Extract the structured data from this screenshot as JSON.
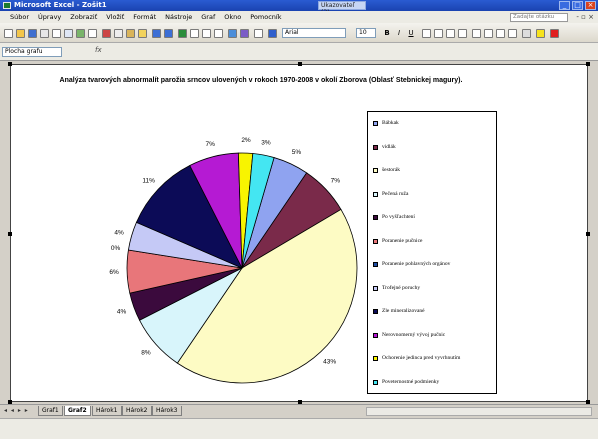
{
  "window": {
    "title": "Microsoft Excel - Zošit1",
    "ask_box": "Ukazovateľ (3)"
  },
  "menu": {
    "items": [
      "Súbor",
      "Úpravy",
      "Zobraziť",
      "Vložiť",
      "Formát",
      "Nástroje",
      "Graf",
      "Okno",
      "Pomocník"
    ],
    "help_placeholder": "Zadajte otázku"
  },
  "toolbar": {
    "font": "Arial",
    "size": "10",
    "bold": "B",
    "italic": "I",
    "underline": "U"
  },
  "namebox": {
    "value": "Plocha grafu"
  },
  "chart_data": {
    "type": "pie",
    "title": "Analýza tvarových abnormalít parožia srncov ulovených v rokoch 1970-2008 v okolí Zborova (Oblasť Stebnickej magury).",
    "slices": [
      {
        "label": "Bábkak",
        "value": 5,
        "pct_label": "5%",
        "color": "#8fa3f0"
      },
      {
        "label": "vidlák",
        "value": 7,
        "pct_label": "7%",
        "color": "#7a2a4a"
      },
      {
        "label": "šestorák",
        "value": 43,
        "pct_label": "43%",
        "color": "#fdfbc4"
      },
      {
        "label": "Pečená ruža",
        "value": 8,
        "pct_label": "8%",
        "color": "#d8f5fb"
      },
      {
        "label": "Po vyšľachtení",
        "value": 4,
        "pct_label": "4%",
        "color": "#3b0a3d"
      },
      {
        "label": "Poranenie pučnice",
        "value": 6,
        "pct_label": "6%",
        "color": "#e8767a"
      },
      {
        "label": "Poranenie pohlavných orgánov",
        "value": 0,
        "pct_label": "0%",
        "color": "#1e4da3"
      },
      {
        "label": "Trofejné poruchy",
        "value": 4,
        "pct_label": "4%",
        "color": "#c5c9f6"
      },
      {
        "label": "Zle mineralizované",
        "value": 11,
        "pct_label": "11%",
        "color": "#0c0b57"
      },
      {
        "label": "Nerovnomerný vývoj pučnic",
        "value": 7,
        "pct_label": "7%",
        "color": "#b51ad3"
      },
      {
        "label": "Ochorenie jedinca pred vyvrhnutím",
        "value": 2,
        "pct_label": "2%",
        "color": "#f8f400"
      },
      {
        "label": "Poveternostné podmienky",
        "value": 3,
        "pct_label": "3%",
        "color": "#44e6f2"
      }
    ]
  },
  "tabs": {
    "items": [
      "Graf1",
      "Graf2",
      "Hárok1",
      "Hárok2",
      "Hárok3"
    ],
    "active": "Graf2"
  }
}
